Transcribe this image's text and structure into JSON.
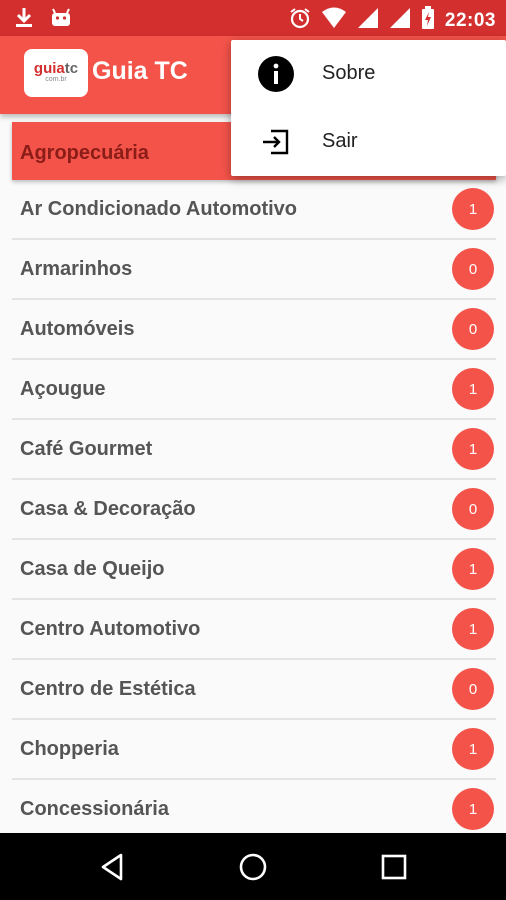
{
  "status_bar": {
    "time": "22:03",
    "left_icons": [
      "download-icon",
      "android-icon"
    ],
    "right_icons": [
      "alarm-icon",
      "wifi-icon",
      "signal-icon",
      "signal-icon",
      "battery-icon"
    ]
  },
  "app_bar": {
    "title": "Guia TC",
    "logo": {
      "text_main": "guia",
      "text_accent": "tc",
      "text_sub": "com.br"
    }
  },
  "overflow_menu": {
    "items": [
      {
        "label": "Sobre",
        "icon": "info-icon"
      },
      {
        "label": "Sair",
        "icon": "exit-icon"
      }
    ]
  },
  "categories": [
    {
      "label": "Agropecuária",
      "count": "",
      "selected": true
    },
    {
      "label": "Ar Condicionado Automotivo",
      "count": "1"
    },
    {
      "label": "Armarinhos",
      "count": "0"
    },
    {
      "label": "Automóveis",
      "count": "0"
    },
    {
      "label": "Açougue",
      "count": "1"
    },
    {
      "label": "Café Gourmet",
      "count": "1"
    },
    {
      "label": "Casa & Decoração",
      "count": "0"
    },
    {
      "label": "Casa de Queijo",
      "count": "1"
    },
    {
      "label": "Centro Automotivo",
      "count": "1"
    },
    {
      "label": "Centro de Estética",
      "count": "0"
    },
    {
      "label": "Chopperia",
      "count": "1"
    },
    {
      "label": "Concessionária",
      "count": "1"
    }
  ],
  "nav_bar": {
    "buttons": [
      "back-icon",
      "home-icon",
      "recents-icon"
    ]
  },
  "colors": {
    "status_bar": "#d32f2f",
    "primary": "#f4534a",
    "badge": "#f4534a",
    "nav_bar": "#000000"
  }
}
